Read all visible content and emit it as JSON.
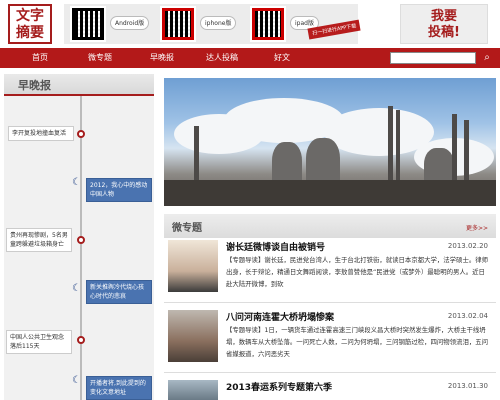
{
  "header": {
    "logo_text": "文字\n摘要",
    "apps": [
      {
        "label": "Android版"
      },
      {
        "label": "iphone版"
      },
      {
        "label": "ipad版"
      }
    ],
    "ribbon": "扫一扫进行APP下载",
    "submit_label": "我要\n投稿!"
  },
  "nav": {
    "items": [
      "首页",
      "微专题",
      "早晚报",
      "达人投稿",
      "好文"
    ],
    "search_placeholder": ""
  },
  "sidebar": {
    "title": "早晚报",
    "items": [
      {
        "text": "李开复投地撞血复活",
        "style": "white"
      },
      {
        "text": "2012，我心中的感动中国人物",
        "style": "blue"
      },
      {
        "text": "贵州再现惨剧，5名男童跨躲避垃圾箱身亡",
        "style": "white"
      },
      {
        "text": "新关推舆冷代烧心孩心时代的悲哀",
        "style": "blue"
      },
      {
        "text": "中国人公共卫生观念落后115天",
        "style": "white"
      },
      {
        "text": "开播者将,到此提到的变化文意地址",
        "style": "blue"
      }
    ]
  },
  "section": {
    "title": "微专题",
    "more": "更多>>"
  },
  "articles": [
    {
      "title": "谢长廷微博谈自由被销号",
      "date": "2013.02.20",
      "body": "【专题导读】谢长廷，民进党台湾人，生于台北打铁街，就读日本京都大学，法学硕士。律师出身，长于辩论，精通日文舞蹈阅读，李敖曾赞他是“民进党（或梦外）最聪明的男人。近日赴大陆开微博，到砍"
    },
    {
      "title": "八问河南连霍大桥坍塌惨案",
      "date": "2013.02.04",
      "body": "【专题导读】1日，一辆货车通过连霍高速三门峡段义昌大桥时突然发生爆炸，大桥主干线坍塌，数辆车从大桥坠落。一问死亡人数，二问为何坍塌，三问钢筋过检，四问物领流泪，五问省媒报道，六问恶劣天"
    },
    {
      "title": "2013春运系列专题第六季",
      "date": "2013.01.30",
      "body": ""
    }
  ]
}
